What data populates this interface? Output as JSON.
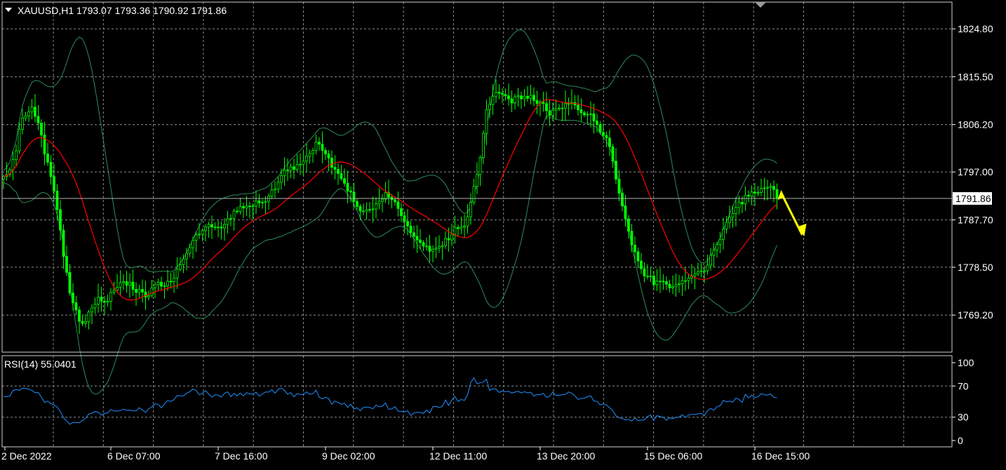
{
  "header": {
    "symbol_line": "XAUUSD,H1  1793.07 1793.36 1790.92 1791.86"
  },
  "rsi_panel": {
    "label": "RSI(14) 55.0401"
  },
  "colors": {
    "background": "#000000",
    "grid": "#8c8c8c",
    "candle": "#00ff00",
    "ma": "#ff0000",
    "bands": "#2e8b57",
    "rsi": "#1e90ff",
    "arrow": "#ffff00",
    "text": "#ffffff",
    "price_line": "#b0b0b0"
  },
  "chart_data": [
    {
      "type": "candlestick",
      "title": "XAUUSD,H1",
      "ylim": [
        1762.0,
        1830.0
      ],
      "y_ticks": [
        "1824.80",
        "1815.50",
        "1806.20",
        "1797.00",
        "1787.70",
        "1778.50",
        "1769.20"
      ],
      "y_tick_values": [
        1824.8,
        1815.5,
        1806.2,
        1797.0,
        1787.7,
        1778.5,
        1769.2
      ],
      "current_price": "1791.86",
      "current_price_value": 1791.86,
      "x_ticks": [
        "2 Dec 2022",
        "6 Dec 07:00",
        "7 Dec 16:00",
        "9 Dec 02:00",
        "12 Dec 11:00",
        "13 Dec 20:00",
        "15 Dec 06:00",
        "16 Dec 15:00"
      ],
      "x_tick_bar_index": [
        0,
        34,
        68,
        102,
        136,
        170,
        204,
        238
      ],
      "indicators": [
        "Moving Average",
        "Bollinger Bands"
      ],
      "series": [
        {
          "name": "close",
          "values": [
            1796.1,
            1796.5,
            1797.4,
            1799.4,
            1801.1,
            1805.3,
            1807.5,
            1807.9,
            1808.7,
            1809.6,
            1807.8,
            1806.5,
            1804.2,
            1800.5,
            1798.9,
            1796.1,
            1793.3,
            1789.7,
            1785.7,
            1780.6,
            1777.5,
            1773.5,
            1771.6,
            1770.2,
            1768.0,
            1767.6,
            1767.9,
            1769.8,
            1770.6,
            1771.3,
            1772.7,
            1771.9,
            1771.7,
            1771.9,
            1773.6,
            1774.0,
            1774.6,
            1775.5,
            1775.7,
            1775.0,
            1775.6,
            1774.2,
            1773.6,
            1774.2,
            1773.7,
            1772.7,
            1773.0,
            1774.5,
            1775.1,
            1775.6,
            1774.8,
            1774.9,
            1775.8,
            1775.7,
            1776.4,
            1778.1,
            1779.0,
            1780.1,
            1781.2,
            1782.3,
            1783.7,
            1784.8,
            1784.9,
            1785.6,
            1786.3,
            1786.8,
            1786.3,
            1786.3,
            1786.3,
            1786.1,
            1786.8,
            1787.9,
            1788.0,
            1789.4,
            1789.3,
            1790.3,
            1790.0,
            1790.4,
            1790.3,
            1790.4,
            1791.4,
            1791.0,
            1791.1,
            1791.3,
            1792.3,
            1793.5,
            1793.7,
            1795.0,
            1796.3,
            1797.4,
            1797.3,
            1798.0,
            1797.5,
            1798.4,
            1798.5,
            1799.1,
            1800.1,
            1800.6,
            1801.2,
            1802.8,
            1802.4,
            1801.2,
            1800.5,
            1799.7,
            1797.9,
            1797.5,
            1796.7,
            1795.7,
            1794.8,
            1793.3,
            1793.1,
            1791.3,
            1790.3,
            1789.4,
            1789.4,
            1789.7,
            1789.7,
            1789.8,
            1790.8,
            1791.3,
            1791.7,
            1793.0,
            1792.1,
            1791.6,
            1791.2,
            1789.9,
            1788.5,
            1787.4,
            1786.5,
            1785.2,
            1784.5,
            1783.8,
            1783.3,
            1782.6,
            1782.6,
            1781.6,
            1782.0,
            1782.2,
            1782.5,
            1782.7,
            1784.1,
            1783.8,
            1784.9,
            1786.2,
            1786.0,
            1786.3,
            1786.5,
            1788.3,
            1791.1,
            1794.2,
            1796.5,
            1799.8,
            1804.5,
            1809.1,
            1810.1,
            1811.7,
            1812.5,
            1812.3,
            1812.1,
            1811.8,
            1811.2,
            1810.4,
            1811.6,
            1811.8,
            1811.2,
            1811.7,
            1811.3,
            1811.9,
            1810.9,
            1810.3,
            1810.6,
            1810.3,
            1808.9,
            1808.0,
            1809.0,
            1809.3,
            1809.4,
            1809.4,
            1810.3,
            1810.3,
            1810.5,
            1810.0,
            1809.1,
            1808.5,
            1808.1,
            1808.2,
            1808.3,
            1806.9,
            1806.2,
            1804.7,
            1804.1,
            1803.6,
            1801.9,
            1799.1,
            1795.6,
            1792.9,
            1790.4,
            1787.9,
            1785.5,
            1782.8,
            1781.5,
            1779.7,
            1778.2,
            1776.8,
            1776.8,
            1776.8,
            1775.1,
            1775.8,
            1775.8,
            1775.7,
            1775.2,
            1774.5,
            1774.7,
            1775.1,
            1775.3,
            1775.9,
            1775.9,
            1776.4,
            1776.8,
            1777.2,
            1777.6,
            1777.8,
            1777.8,
            1778.9,
            1780.8,
            1781.8,
            1782.9,
            1783.9,
            1785.9,
            1787.2,
            1788.2,
            1788.9,
            1790.1,
            1791.1,
            1790.8,
            1792.5,
            1792.3,
            1793.1,
            1792.9,
            1793.0,
            1793.8,
            1793.9,
            1794.0,
            1794.2,
            1793.6,
            1791.86
          ]
        }
      ]
    },
    {
      "type": "line",
      "title": "RSI(14) 55.0401",
      "ylim": [
        0,
        100
      ],
      "y_ticks": [
        "100",
        "70",
        "30",
        "0"
      ],
      "y_tick_values": [
        100,
        70,
        30,
        0
      ],
      "current_value": 55.0401,
      "series": [
        {
          "name": "RSI(14)",
          "values": [
            56.7,
            56.4,
            56.9,
            64.3,
            65.4,
            64.4,
            67.1,
            66.9,
            66.0,
            64.3,
            61.4,
            61.7,
            55.9,
            48.9,
            50.6,
            47.3,
            45.8,
            43.0,
            37.2,
            29.4,
            25.3,
            20.9,
            23.3,
            23.2,
            22.9,
            25.9,
            28.4,
            34.1,
            35.1,
            37.2,
            36.4,
            32.6,
            34.8,
            35.7,
            39.7,
            38.1,
            37.8,
            38.6,
            40.3,
            38.8,
            39.2,
            37.9,
            38.2,
            42.1,
            39.4,
            36.2,
            40.8,
            43.3,
            47.0,
            46.6,
            42.0,
            47.4,
            51.4,
            50.2,
            52.5,
            57.7,
            57.4,
            57.3,
            60.9,
            62.7,
            66.0,
            64.3,
            58.7,
            60.6,
            64.2,
            59.8,
            55.9,
            58.7,
            58.3,
            55.8,
            60.7,
            62.5,
            56.4,
            60.6,
            57.4,
            60.9,
            57.4,
            61.4,
            59.9,
            59.6,
            62.0,
            57.0,
            59.9,
            62.4,
            62.2,
            65.2,
            60.8,
            65.7,
            67.2,
            64.4,
            59.5,
            61.6,
            56.1,
            60.4,
            59.3,
            59.0,
            62.5,
            59.3,
            60.3,
            64.7,
            55.5,
            53.5,
            55.6,
            53.9,
            46.7,
            50.7,
            48.8,
            46.6,
            48.0,
            42.5,
            46.7,
            40.4,
            42.1,
            38.4,
            42.6,
            43.0,
            42.6,
            40.7,
            45.5,
            43.2,
            44.2,
            48.2,
            40.2,
            40.6,
            43.5,
            37.6,
            37.4,
            36.7,
            38.3,
            32.2,
            35.3,
            36.4,
            36.0,
            34.8,
            39.2,
            35.2,
            43.6,
            43.8,
            42.5,
            43.7,
            52.1,
            45.1,
            51.8,
            56.7,
            50.1,
            52.8,
            51.5,
            58.6,
            74.4,
            80.5,
            72.9,
            74.1,
            75.1,
            78.6,
            64.3,
            66.5,
            66.2,
            61.7,
            63.7,
            62.6,
            63.2,
            60.9,
            62.2,
            63.2,
            61.1,
            62.7,
            61.2,
            62.2,
            57.1,
            59.1,
            58.8,
            60.6,
            55.5,
            56.6,
            62.3,
            57.8,
            58.3,
            58.8,
            59.3,
            62.3,
            60.8,
            57.4,
            52.9,
            53.9,
            54.4,
            56.6,
            57.4,
            50.8,
            50.4,
            45.9,
            47.0,
            45.8,
            42.0,
            38.4,
            31.8,
            29.4,
            28.3,
            26.6,
            27.1,
            25.0,
            29.0,
            25.5,
            26.2,
            26.6,
            30.9,
            32.6,
            26.0,
            32.0,
            30.7,
            29.7,
            26.0,
            29.2,
            28.1,
            29.9,
            30.0,
            33.0,
            29.7,
            32.6,
            33.6,
            33.4,
            34.5,
            35.0,
            32.1,
            38.5,
            41.3,
            38.9,
            43.3,
            44.7,
            51.4,
            49.8,
            50.5,
            49.2,
            54.6,
            52.7,
            49.2,
            59.5,
            54.6,
            58.1,
            55.3,
            56.0,
            60.3,
            58.9,
            58.2,
            59.9,
            55.3,
            55.0401
          ]
        }
      ]
    }
  ]
}
